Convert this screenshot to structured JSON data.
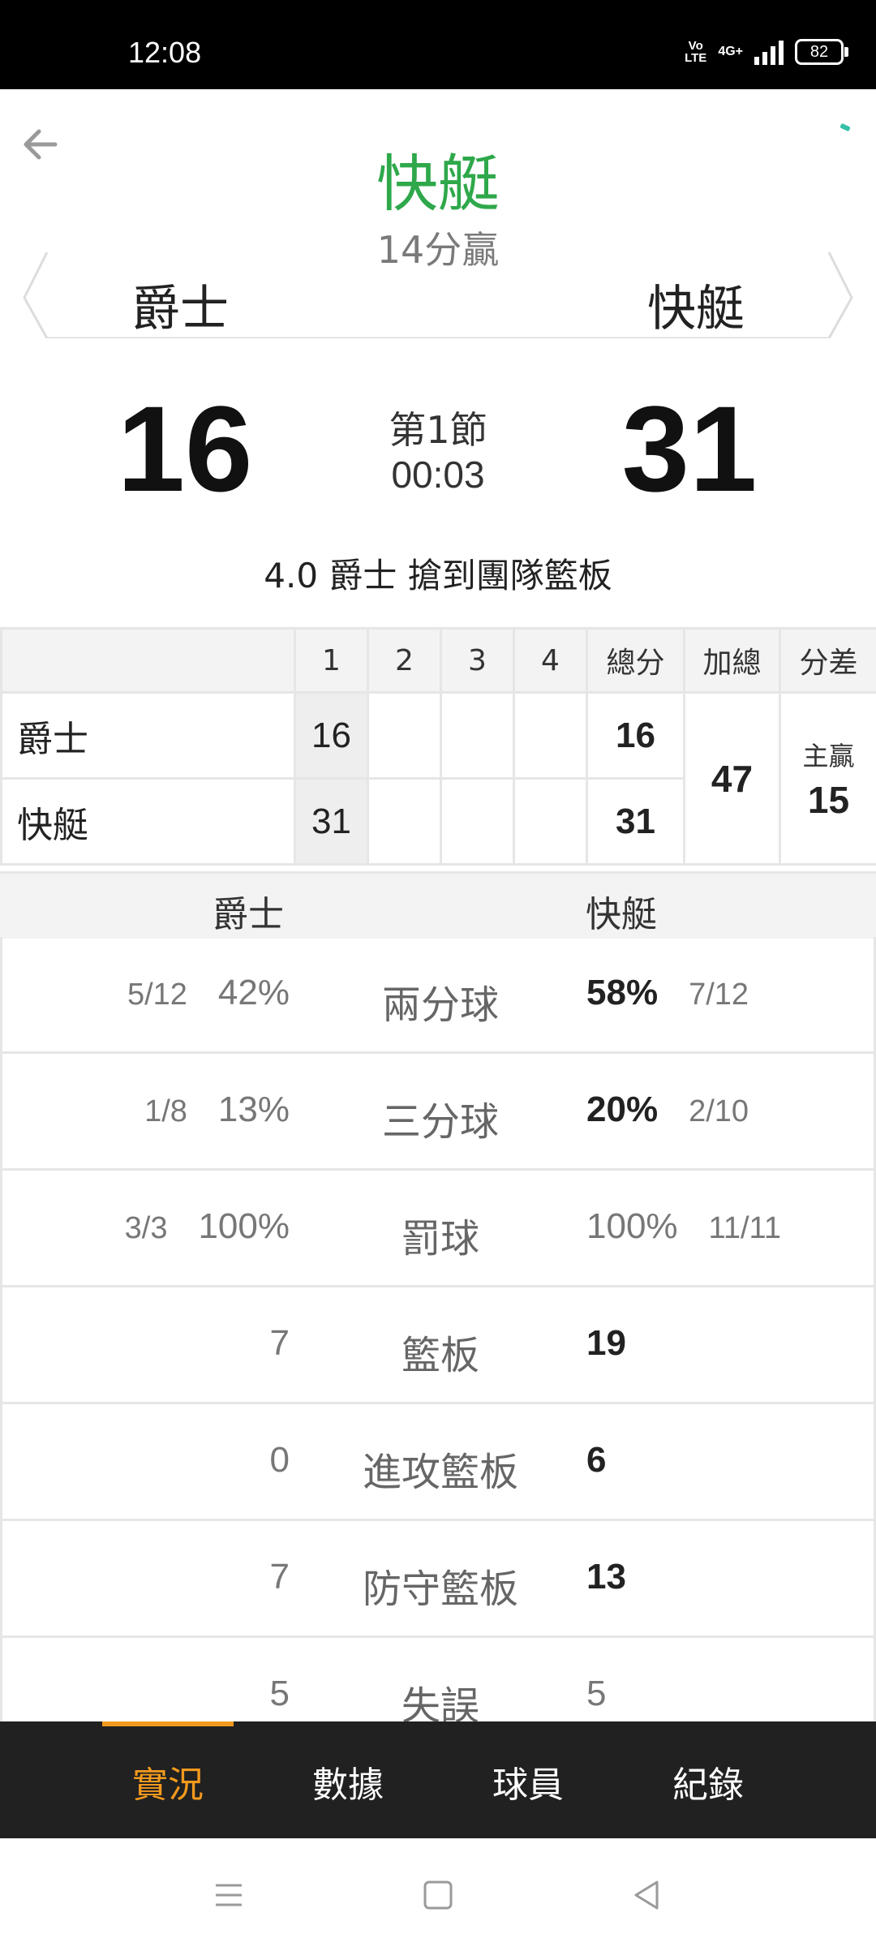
{
  "status_bar": {
    "time": "12:08",
    "volte": "Vo LTE",
    "network": "4G+",
    "battery": "82"
  },
  "header": {
    "winner": "快艇",
    "margin": "14分贏",
    "away_team": "爵士",
    "home_team": "快艇",
    "accent_color": "#2ea84a"
  },
  "scoreboard": {
    "away_score": "16",
    "home_score": "31",
    "period": "第1節",
    "clock": "00:03",
    "last_play": "4.0 爵士  搶到團隊籃板"
  },
  "quarter_table": {
    "headers": [
      "1",
      "2",
      "3",
      "4",
      "總分",
      "加總",
      "分差"
    ],
    "rows": [
      {
        "team": "爵士",
        "q1": "16",
        "q2": "",
        "q3": "",
        "q4": "",
        "total": "16"
      },
      {
        "team": "快艇",
        "q1": "31",
        "q2": "",
        "q3": "",
        "q4": "",
        "total": "31"
      }
    ],
    "combined": "47",
    "diff_label": "主贏",
    "diff_value": "15"
  },
  "stats": {
    "away_team": "爵士",
    "home_team": "快艇",
    "rows": [
      {
        "label": "兩分球",
        "away_frac": "5/12",
        "away_pct": "42%",
        "home_pct": "58%",
        "home_frac": "7/12",
        "home_bold": true
      },
      {
        "label": "三分球",
        "away_frac": "1/8",
        "away_pct": "13%",
        "home_pct": "20%",
        "home_frac": "2/10",
        "home_bold": true
      },
      {
        "label": "罰球",
        "away_frac": "3/3",
        "away_pct": "100%",
        "home_pct": "100%",
        "home_frac": "11/11",
        "home_bold": false
      },
      {
        "label": "籃板",
        "away_value": "7",
        "home_value": "19"
      },
      {
        "label": "進攻籃板",
        "away_value": "0",
        "home_value": "6"
      },
      {
        "label": "防守籃板",
        "away_value": "7",
        "home_value": "13"
      },
      {
        "label": "失誤",
        "away_value": "5",
        "home_value": "5"
      }
    ]
  },
  "tabs": [
    {
      "label": "實況",
      "active": true
    },
    {
      "label": "數據",
      "active": false
    },
    {
      "label": "球員",
      "active": false
    },
    {
      "label": "紀錄",
      "active": false
    }
  ],
  "icons": {
    "back": "back-arrow-icon",
    "menu": "menu-icon",
    "home": "home-icon",
    "nav_back": "nav-back-icon"
  },
  "colors": {
    "tab_active": "#f29a1d",
    "tab_bar": "#212121"
  }
}
